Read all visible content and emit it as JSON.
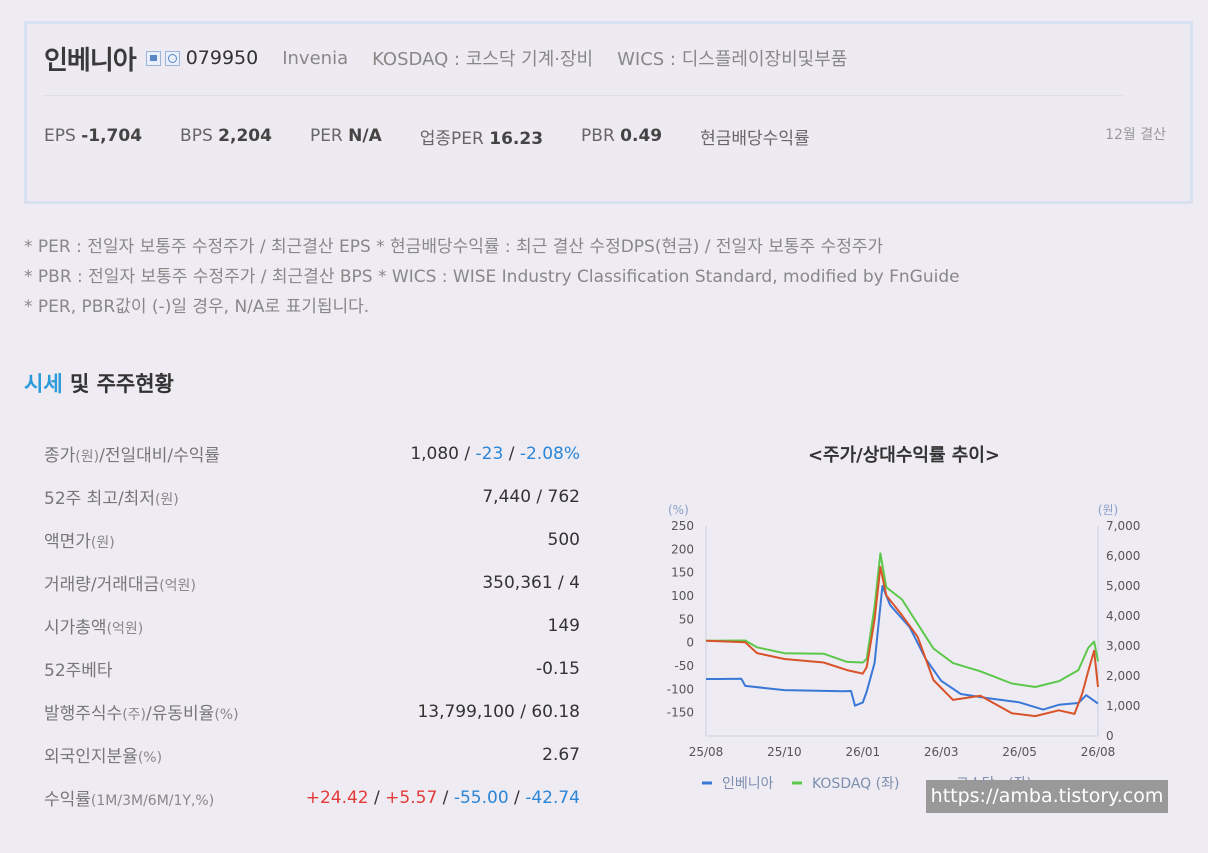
{
  "company": {
    "name": "인베니아",
    "icons": [
      "home-icon",
      "phone-icon"
    ],
    "code": "079950",
    "eng_name": "Invenia",
    "market": "KOSDAQ : 코스닥 기계·장비",
    "wics": "WICS : 디스플레이장비및부품"
  },
  "stats": {
    "eps_label": "EPS",
    "eps": "-1,704",
    "bps_label": "BPS",
    "bps": "2,204",
    "per_label": "PER",
    "per": "N/A",
    "ind_per_label": "업종PER",
    "ind_per": "16.23",
    "pbr_label": "PBR",
    "pbr": "0.49",
    "dividend_label": "현금배당수익률",
    "settlement": "12월 결산"
  },
  "notes": [
    "* PER : 전일자 보통주 수정주가 / 최근결산 EPS * 현금배당수익률 : 최근 결산 수정DPS(현금) / 전일자 보통주 수정주가",
    "* PBR : 전일자 보통주 수정주가 / 최근결산 BPS * WICS : WISE Industry Classification Standard, modified by FnGuide",
    "* PER, PBR값이 (-)일 경우, N/A로 표기됩니다."
  ],
  "section": {
    "highlight": "시세",
    "rest": " 및 주주현황"
  },
  "rows": [
    {
      "label": "종가",
      "sub": "(원)",
      "label2": "/전일대비/수익률"
    },
    {
      "label": "52주 최고/최저",
      "sub": "(원)",
      "label2": "",
      "value": "7,440 / 762"
    },
    {
      "label": "액면가",
      "sub": "(원)",
      "label2": "",
      "value": "500"
    },
    {
      "label": "거래량/거래대금",
      "sub": "(억원)",
      "label2": "",
      "value": "350,361 / 4"
    },
    {
      "label": "시가총액",
      "sub": "(억원)",
      "label2": "",
      "value": "149"
    },
    {
      "label": "52주베타",
      "sub": "",
      "label2": "",
      "value": "-0.15"
    },
    {
      "label": "발행주식수",
      "sub": "(주)",
      "label2": "/유동비율",
      "sub2": "(%)",
      "value": "13,799,100 / 60.18"
    },
    {
      "label": "외국인지분율",
      "sub": "(%)",
      "label2": "",
      "value": "2.67"
    },
    {
      "label": "수익률",
      "sub": "(1M/3M/6M/1Y,%)",
      "label2": ""
    }
  ],
  "price_row": {
    "close": "1,080",
    "change": "-23",
    "rate": "-2.08%"
  },
  "returns_row": {
    "m1": "+24.42",
    "m3": "+5.57",
    "m6": "-55.00",
    "y1": "-42.74"
  },
  "chart_title": "<주가/상대수익률 추이>",
  "chart_data": {
    "type": "line",
    "y_left_unit": "(%)",
    "y_right_unit": "(원)",
    "y_left_ticks": [
      "250",
      "200",
      "150",
      "100",
      "50",
      "0",
      "-50",
      "-100",
      "-150"
    ],
    "y_right_ticks": [
      "7,000",
      "6,000",
      "5,000",
      "4,000",
      "3,000",
      "2,000",
      "1,000",
      "0"
    ],
    "x_ticks": [
      "25/08",
      "25/10",
      "26/01",
      "26/03",
      "26/05",
      "26/08"
    ],
    "ylim_left": [
      -200,
      250
    ],
    "ylim_right": [
      0,
      7000
    ],
    "series": [
      {
        "name": "인베니아",
        "color": "#3a78d8",
        "axis": "right",
        "points": [
          [
            0,
            1900
          ],
          [
            0.03,
            1900
          ],
          [
            0.09,
            1950
          ],
          [
            0.1,
            1650
          ],
          [
            0.2,
            1550
          ],
          [
            0.35,
            1450
          ],
          [
            0.37,
            1500
          ],
          [
            0.38,
            1050
          ],
          [
            0.4,
            1100
          ],
          [
            0.41,
            1500
          ],
          [
            0.43,
            2400
          ],
          [
            0.45,
            5000
          ],
          [
            0.47,
            4400
          ],
          [
            0.52,
            3600
          ],
          [
            0.56,
            2600
          ],
          [
            0.6,
            1800
          ],
          [
            0.65,
            1400
          ],
          [
            0.72,
            1300
          ],
          [
            0.8,
            1100
          ],
          [
            0.86,
            900
          ],
          [
            0.9,
            1000
          ],
          [
            0.95,
            1100
          ],
          [
            0.97,
            1400
          ],
          [
            1,
            1080
          ]
        ]
      },
      {
        "name": "KOSDAQ (좌)",
        "color": "#5cc84a",
        "axis": "left",
        "points": [
          [
            0,
            4
          ],
          [
            0.1,
            2
          ],
          [
            0.13,
            -10
          ],
          [
            0.2,
            -20
          ],
          [
            0.3,
            -25
          ],
          [
            0.36,
            -40
          ],
          [
            0.4,
            -45
          ],
          [
            0.41,
            -35
          ],
          [
            0.43,
            80
          ],
          [
            0.445,
            190
          ],
          [
            0.46,
            120
          ],
          [
            0.5,
            90
          ],
          [
            0.54,
            40
          ],
          [
            0.58,
            -10
          ],
          [
            0.63,
            -45
          ],
          [
            0.7,
            -60
          ],
          [
            0.78,
            -90
          ],
          [
            0.84,
            -95
          ],
          [
            0.9,
            -80
          ],
          [
            0.95,
            -60
          ],
          [
            0.975,
            -10
          ],
          [
            0.99,
            0
          ],
          [
            1,
            -40
          ]
        ]
      },
      {
        "name": "코스닥 . (좌)",
        "color": "#d8532a",
        "axis": "left",
        "points": [
          [
            0,
            4
          ],
          [
            0.1,
            2
          ],
          [
            0.13,
            -25
          ],
          [
            0.2,
            -35
          ],
          [
            0.3,
            -40
          ],
          [
            0.36,
            -60
          ],
          [
            0.4,
            -65
          ],
          [
            0.41,
            -55
          ],
          [
            0.43,
            50
          ],
          [
            0.445,
            165
          ],
          [
            0.46,
            100
          ],
          [
            0.5,
            60
          ],
          [
            0.54,
            10
          ],
          [
            0.58,
            -80
          ],
          [
            0.63,
            -120
          ],
          [
            0.7,
            -115
          ],
          [
            0.78,
            -150
          ],
          [
            0.84,
            -160
          ],
          [
            0.9,
            -145
          ],
          [
            0.94,
            -150
          ],
          [
            0.96,
            -110
          ],
          [
            0.975,
            -60
          ],
          [
            0.99,
            -20
          ],
          [
            1,
            -95
          ]
        ]
      }
    ]
  },
  "watermark": "https://amba.tistory.com"
}
